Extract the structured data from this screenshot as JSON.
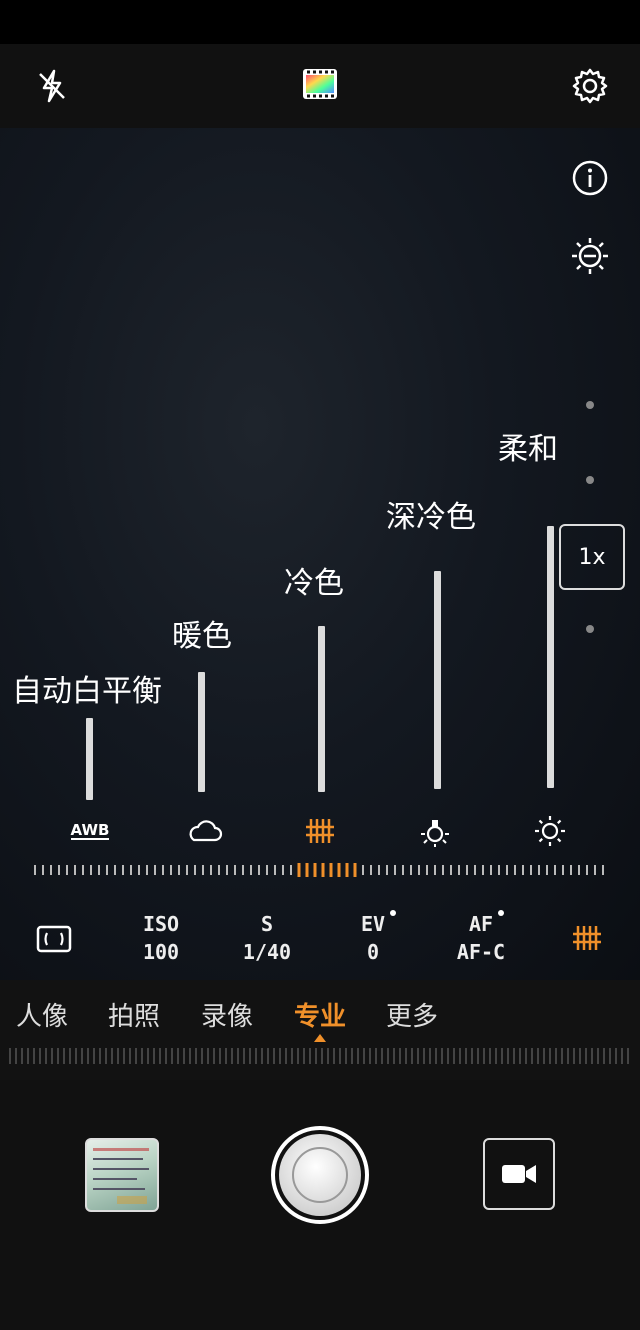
{
  "colors": {
    "accent": "#f0902a",
    "bar": "#dcdcdc"
  },
  "toolbar": {
    "flash_icon": "flash-off-icon",
    "filter_icon": "filter-color-icon",
    "settings_icon": "gear-icon"
  },
  "side": {
    "info_icon": "info-icon",
    "exposure_icon": "brightness-minus-icon",
    "zoom_label": "1x"
  },
  "white_balance": {
    "presets": [
      {
        "label": "自动白平衡",
        "icon": "awb-icon",
        "icon_text": "AWB"
      },
      {
        "label": "暖色",
        "icon": "cloud-icon"
      },
      {
        "label": "冷色",
        "icon": "fluorescent-icon",
        "selected": true
      },
      {
        "label": "深冷色",
        "icon": "incandescent-bulb-icon"
      },
      {
        "label": "柔和",
        "icon": "sun-icon"
      }
    ]
  },
  "params": {
    "metering_icon": "metering-icon",
    "iso": {
      "title": "ISO",
      "value": "100"
    },
    "shutter": {
      "title": "S",
      "value": "1/40"
    },
    "ev": {
      "title": "EV",
      "value": "0"
    },
    "af": {
      "title": "AF",
      "value": "AF-C"
    },
    "wb_icon": "fluorescent-icon"
  },
  "modes": {
    "items": [
      "人像",
      "拍照",
      "录像",
      "专业",
      "更多"
    ],
    "active": "专业"
  },
  "bottom": {
    "gallery_icon": "gallery-thumbnail",
    "shutter_icon": "shutter-button",
    "video_icon": "video-camera-icon"
  }
}
